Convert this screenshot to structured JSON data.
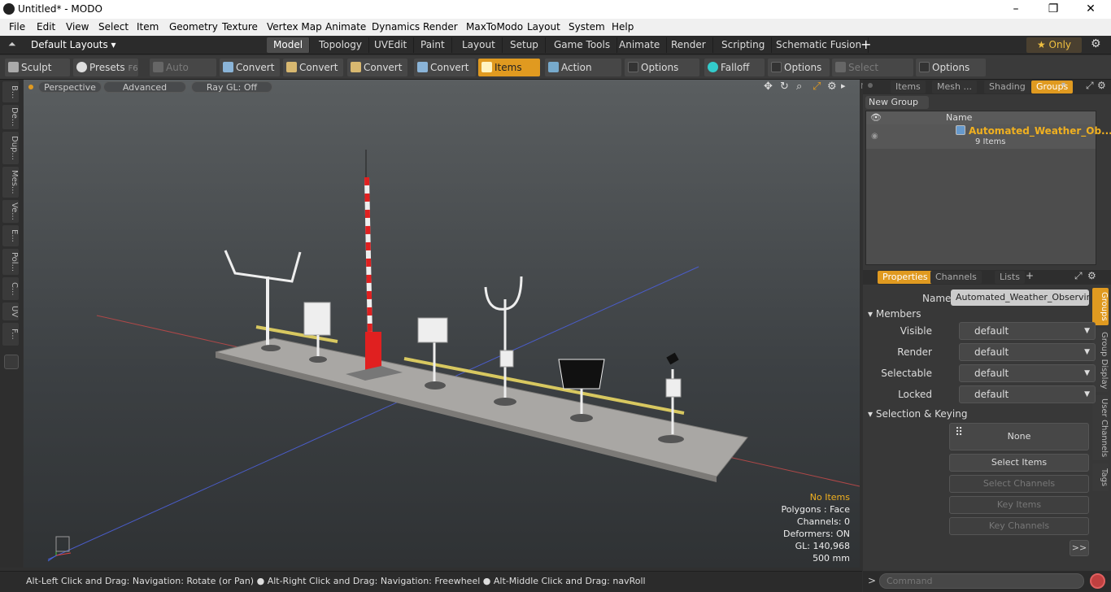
{
  "window": {
    "title": "Untitled* - MODO",
    "min": "–",
    "max": "❐",
    "close": "✕"
  },
  "menu": [
    "File",
    "Edit",
    "View",
    "Select",
    "Item",
    "Geometry",
    "Texture",
    "Vertex Map",
    "Animate",
    "Dynamics",
    "Render",
    "MaxToModo",
    "Layout",
    "System",
    "Help"
  ],
  "layoutbar": {
    "preset": "Default Layouts ▾",
    "tabs": [
      "Model",
      "Topology",
      "UVEdit",
      "Paint",
      "Layout",
      "Setup",
      "Game Tools",
      "Animate",
      "Render",
      "Scripting",
      "Schematic Fusion"
    ],
    "active": "Model",
    "plus": "+",
    "only": "★ Only",
    "gear": "⚙"
  },
  "toolbar": {
    "sculpt": "Sculpt",
    "presets": "Presets",
    "presets_key": "F6",
    "auto_select": "Auto Select",
    "convert": "Convert",
    "items": "Items",
    "action_center": "Action Center",
    "options": "Options",
    "falloff": "Falloff",
    "select_through": "Select Through"
  },
  "lefttabs": [
    "B...",
    "De...",
    "Dup...",
    "Mes...",
    "Ve...",
    "E...",
    "Pol...",
    "C...",
    "UV",
    "F..."
  ],
  "viewport": {
    "view": "Perspective",
    "shading": "Advanced",
    "raygl": "Ray GL: Off",
    "info": {
      "selection": "No Items",
      "polygons": "Polygons : Face",
      "channels": "Channels: 0",
      "deformers": "Deformers: ON",
      "gl": "GL: 140,968",
      "scale": "500 mm"
    }
  },
  "status": "Alt-Left Click and Drag: Navigation: Rotate (or Pan) ● Alt-Right Click and Drag: Navigation: Freewheel ● Alt-Middle Click and Drag: navRoll",
  "groups_panel": {
    "tabs": [
      "Items",
      "Mesh ...",
      "Shading",
      "Groups"
    ],
    "active": "Groups",
    "new_group": "New Group",
    "col_name": "Name",
    "group_name": "Automated_Weather_Ob...",
    "group_count": "9 Items"
  },
  "properties": {
    "tabs": [
      "Properties",
      "Channels",
      "Lists"
    ],
    "active": "Properties",
    "plus": "+",
    "name_label": "Name",
    "name_value": "Automated_Weather_Observing",
    "members": "Members",
    "visible_label": "Visible",
    "render_label": "Render",
    "selectable_label": "Selectable",
    "locked_label": "Locked",
    "default": "default",
    "sel_keying": "Selection & Keying",
    "none": "None",
    "select_items": "Select Items",
    "select_channels": "Select Channels",
    "key_items": "Key Items",
    "key_channels": "Key Channels",
    "more": ">>",
    "side_tabs": [
      "Groups",
      "Group Display",
      "User Channels",
      "Tags"
    ]
  },
  "command": {
    "placeholder": "Command",
    "prompt": ">"
  },
  "colors": {
    "accent": "#e09a20",
    "active_tab": "#4d4d4d"
  }
}
